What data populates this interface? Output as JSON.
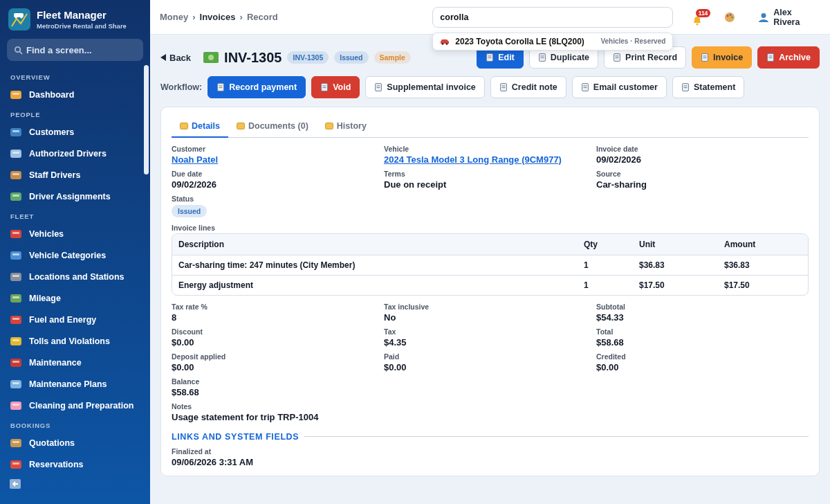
{
  "sidebar": {
    "title": "Fleet Manager",
    "subtitle": "MetroDrive Rental and Share",
    "search": {
      "placeholder": "Find a screen..."
    },
    "sections": [
      {
        "heading": "OVERVIEW",
        "items": [
          {
            "label": "Dashboard"
          }
        ]
      },
      {
        "heading": "PEOPLE",
        "items": [
          {
            "label": "Customers"
          },
          {
            "label": "Authorized Drivers"
          },
          {
            "label": "Staff Drivers"
          },
          {
            "label": "Driver Assignments"
          }
        ]
      },
      {
        "heading": "FLEET",
        "items": [
          {
            "label": "Vehicles"
          },
          {
            "label": "Vehicle Categories"
          },
          {
            "label": "Locations and Stations"
          },
          {
            "label": "Mileage"
          },
          {
            "label": "Fuel and Energy"
          },
          {
            "label": "Tolls and Violations"
          },
          {
            "label": "Maintenance"
          },
          {
            "label": "Maintenance Plans"
          },
          {
            "label": "Cleaning and Preparation"
          }
        ]
      },
      {
        "heading": "BOOKINGS",
        "items": [
          {
            "label": "Quotations"
          },
          {
            "label": "Reservations"
          }
        ]
      }
    ]
  },
  "topbar": {
    "breadcrumbs": [
      {
        "label": "Money",
        "emphasized": false
      },
      {
        "label": "Invoices",
        "emphasized": true
      },
      {
        "label": "Record",
        "emphasized": false
      }
    ],
    "separator": "›",
    "search": {
      "value": "corolla",
      "results": [
        {
          "label": "2023 Toyota Corolla LE (8LQ200)",
          "meta": "Vehicles · Reserved"
        }
      ]
    },
    "notifications": "114",
    "user": "Alex Rivera"
  },
  "header": {
    "back": "Back",
    "title": "INV-1305",
    "badges": [
      {
        "label": "INV-1305",
        "color": "#2f6fb8"
      },
      {
        "label": "Issued",
        "color": "#2f6fb8"
      },
      {
        "label": "Sample",
        "color": "#d9892b"
      }
    ],
    "actions": [
      {
        "label": "Edit",
        "kind": "primary"
      },
      {
        "label": "Duplicate",
        "kind": "default"
      },
      {
        "label": "Print Record",
        "kind": "default"
      },
      {
        "label": "Invoice",
        "kind": "warning"
      },
      {
        "label": "Archive",
        "kind": "danger"
      }
    ]
  },
  "workflow": {
    "label": "Workflow:",
    "buttons": [
      {
        "label": "Record payment",
        "kind": "primary"
      },
      {
        "label": "Void",
        "kind": "danger"
      },
      {
        "label": "Supplemental invoice",
        "kind": "default"
      },
      {
        "label": "Credit note",
        "kind": "default"
      },
      {
        "label": "Email customer",
        "kind": "default"
      },
      {
        "label": "Statement",
        "kind": "default"
      }
    ]
  },
  "tabs": [
    {
      "label": "Details",
      "selected": true
    },
    {
      "label": "Documents (0)",
      "selected": false
    },
    {
      "label": "History",
      "selected": false
    }
  ],
  "fields": [
    {
      "label": "Customer",
      "value": "Noah Patel",
      "kind": "link"
    },
    {
      "label": "Vehicle",
      "value": "2024 Tesla Model 3 Long Range (9CM977)",
      "kind": "link"
    },
    {
      "label": "Invoice date",
      "value": "09/02/2026",
      "kind": "text"
    },
    {
      "label": "Due date",
      "value": "09/02/2026",
      "kind": "text"
    },
    {
      "label": "Terms",
      "value": "Due on receipt",
      "kind": "text"
    },
    {
      "label": "Source",
      "value": "Car-sharing",
      "kind": "text"
    },
    {
      "label": "Status",
      "value": "Issued",
      "kind": "badge"
    }
  ],
  "lines": {
    "label": "Invoice lines",
    "columns": [
      "Description",
      "Qty",
      "Unit",
      "Amount"
    ],
    "rows": [
      [
        "Car-sharing time: 247 minutes (City Member)",
        "1",
        "$36.83",
        "$36.83"
      ],
      [
        "Energy adjustment",
        "1",
        "$17.50",
        "$17.50"
      ]
    ]
  },
  "totals": [
    {
      "label": "Tax rate %",
      "value": "8"
    },
    {
      "label": "Tax inclusive",
      "value": "No"
    },
    {
      "label": "Subtotal",
      "value": "$54.33"
    },
    {
      "label": "Discount",
      "value": "$0.00"
    },
    {
      "label": "Tax",
      "value": "$4.35"
    },
    {
      "label": "Total",
      "value": "$58.68"
    },
    {
      "label": "Deposit applied",
      "value": "$0.00"
    },
    {
      "label": "Paid",
      "value": "$0.00"
    },
    {
      "label": "Credited",
      "value": "$0.00"
    },
    {
      "label": "Balance",
      "value": "$58.68"
    }
  ],
  "notes": {
    "label": "Notes",
    "value": "Usage statement for trip TRP-1004"
  },
  "system": {
    "heading": "LINKS AND SYSTEM FIELDS",
    "fields": [
      {
        "label": "Finalized at",
        "value": "09/06/2026 3:31 AM"
      }
    ]
  }
}
